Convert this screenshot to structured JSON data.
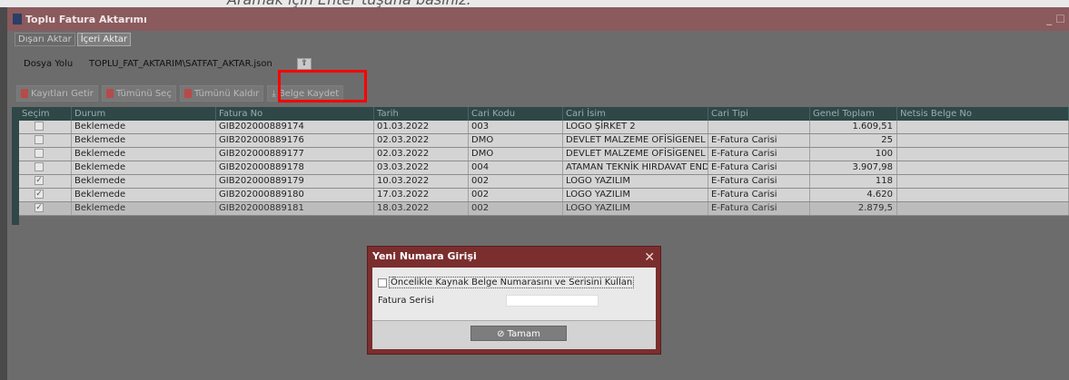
{
  "search": {
    "hint": "Aramak için Enter tuşuna basınız."
  },
  "window": {
    "title": "Toplu Fatura Aktarımı",
    "controls": "_ ☐"
  },
  "tabs": [
    {
      "label": "Dışarı Aktar"
    },
    {
      "label": "İçeri Aktar"
    }
  ],
  "path": {
    "label": "Dosya Yolu",
    "value": "TOPLU_FAT_AKTARIM\\SATFAT_AKTAR.json"
  },
  "toolbar": {
    "get_records": "Kayıtları Getir",
    "select_all": "Tümünü Seç",
    "clear_all": "Tümünü Kaldır",
    "save_document": "Belge Kaydet"
  },
  "grid": {
    "headers": [
      "Seçim",
      "Durum",
      "Fatura No",
      "Tarih",
      "Cari Kodu",
      "Cari İsim",
      "Cari Tipi",
      "Genel Toplam",
      "Netsis Belge No"
    ],
    "rows": [
      {
        "checked": false,
        "status": "Beklemede",
        "invoice": "GIB202000889174",
        "date": "01.03.2022",
        "code": "003",
        "name": "LOGO ŞİRKET 2",
        "type": "",
        "total": "1.609,51",
        "netsis": ""
      },
      {
        "checked": false,
        "status": "Beklemede",
        "invoice": "GIB202000889176",
        "date": "02.03.2022",
        "code": "DMO",
        "name": "DEVLET MALZEME OFİSİGENEL M",
        "type": "E-Fatura Carisi",
        "total": "25",
        "netsis": ""
      },
      {
        "checked": false,
        "status": "Beklemede",
        "invoice": "GIB202000889177",
        "date": "02.03.2022",
        "code": "DMO",
        "name": "DEVLET MALZEME OFİSİGENEL M",
        "type": "E-Fatura Carisi",
        "total": "100",
        "netsis": ""
      },
      {
        "checked": false,
        "status": "Beklemede",
        "invoice": "GIB202000889178",
        "date": "03.03.2022",
        "code": "004",
        "name": "ATAMAN TEKNİK HIRDAVAT END",
        "type": "E-Fatura Carisi",
        "total": "3.907,98",
        "netsis": ""
      },
      {
        "checked": true,
        "status": "Beklemede",
        "invoice": "GIB202000889179",
        "date": "10.03.2022",
        "code": "002",
        "name": "LOGO YAZILIM",
        "type": "E-Fatura Carisi",
        "total": "118",
        "netsis": ""
      },
      {
        "checked": true,
        "status": "Beklemede",
        "invoice": "GIB202000889180",
        "date": "17.03.2022",
        "code": "002",
        "name": "LOGO YAZILIM",
        "type": "E-Fatura Carisi",
        "total": "4.620",
        "netsis": ""
      },
      {
        "checked": true,
        "status": "Beklemede",
        "invoice": "GIB202000889181",
        "date": "18.03.2022",
        "code": "002",
        "name": "LOGO YAZILIM",
        "type": "E-Fatura Carisi",
        "total": "2.879,5",
        "netsis": ""
      }
    ]
  },
  "dialog": {
    "title": "Yeni Numara Girişi",
    "option_label": "Öncelikle Kaynak Belge Numarasını ve Serisini Kullan",
    "field_label": "Fatura Serisi",
    "field_value": "",
    "ok_button": "Tamam"
  }
}
